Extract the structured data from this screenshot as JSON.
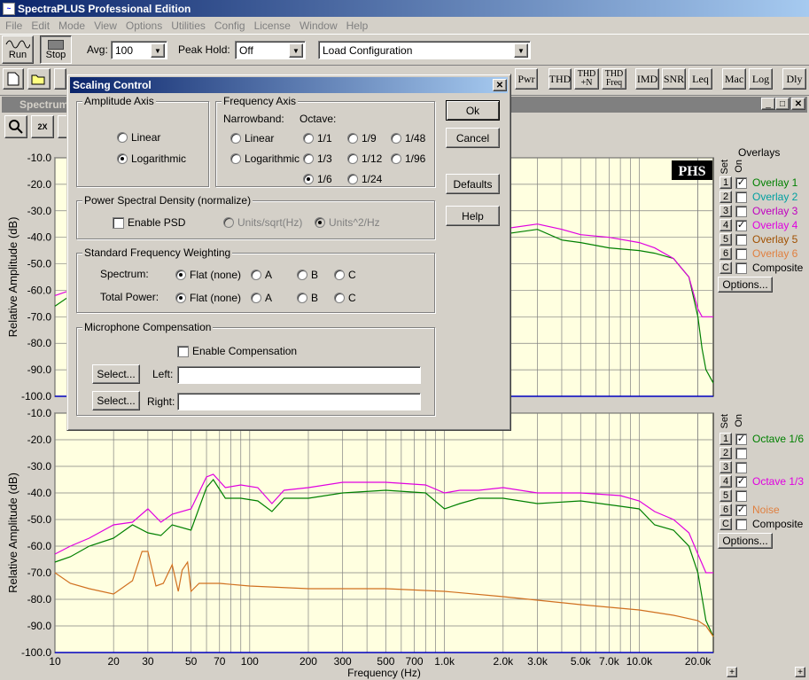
{
  "app": {
    "title": "SpectraPLUS Professional Edition"
  },
  "menu": [
    "File",
    "Edit",
    "Mode",
    "View",
    "Options",
    "Utilities",
    "Config",
    "License",
    "Window",
    "Help"
  ],
  "toolbar": {
    "run_label": "Run",
    "stop_label": "Stop",
    "avg_label": "Avg:",
    "avg_value": "100",
    "peak_label": "Peak Hold:",
    "peak_value": "Off",
    "config_value": "Load Configuration",
    "buttons": [
      "Pwr",
      "THD",
      "THD +N",
      "THD Freq",
      "IMD",
      "SNR",
      "Leq",
      "Mac",
      "Log",
      "Dly"
    ]
  },
  "child_window": {
    "title": "Spectrum",
    "zoom_label": "2X"
  },
  "dialog": {
    "title": "Scaling Control",
    "ok": "Ok",
    "cancel": "Cancel",
    "defaults": "Defaults",
    "help": "Help",
    "amplitude_axis": {
      "title": "Amplitude Axis",
      "linear": "Linear",
      "log": "Logarithmic",
      "selected": "Logarithmic"
    },
    "frequency_axis": {
      "title": "Frequency Axis",
      "narrowband": "Narrowband:",
      "octave": "Octave:",
      "linear": "Linear",
      "log": "Logarithmic",
      "octaves": [
        "1/1",
        "1/9",
        "1/48",
        "1/3",
        "1/12",
        "1/96",
        "1/6",
        "1/24"
      ],
      "selected": "1/6"
    },
    "psd": {
      "title": "Power Spectral Density (normalize)",
      "enable": "Enable PSD",
      "opt1": "Units/sqrt(Hz)",
      "opt2": "Units^2/Hz"
    },
    "weighting": {
      "title": "Standard Frequency Weighting",
      "spectrum": "Spectrum:",
      "total": "Total Power:",
      "flat": "Flat (none)",
      "a": "A",
      "b": "B",
      "c": "C"
    },
    "mic": {
      "title": "Microphone Compensation",
      "enable": "Enable Compensation",
      "select": "Select...",
      "left": "Left:",
      "right": "Right:",
      "left_value": "",
      "right_value": ""
    }
  },
  "overlays_top": {
    "header": "Overlays",
    "set": "Set",
    "on": "On",
    "items": [
      {
        "set": "1",
        "label": "Overlay 1",
        "on": true,
        "color": "#008000"
      },
      {
        "set": "2",
        "label": "Overlay 2",
        "on": false,
        "color": "#00a0a0"
      },
      {
        "set": "3",
        "label": "Overlay 3",
        "on": false,
        "color": "#c000c0"
      },
      {
        "set": "4",
        "label": "Overlay 4",
        "on": true,
        "color": "#e000e0"
      },
      {
        "set": "5",
        "label": "Overlay 5",
        "on": false,
        "color": "#a05000"
      },
      {
        "set": "6",
        "label": "Overlay 6",
        "on": false,
        "color": "#e08040"
      },
      {
        "set": "C",
        "label": "Composite",
        "on": false,
        "color": "#000000"
      }
    ],
    "options": "Options..."
  },
  "overlays_bottom": {
    "set": "Set",
    "on": "On",
    "items": [
      {
        "set": "1",
        "label": "Octave 1/6",
        "on": true,
        "color": "#008000"
      },
      {
        "set": "2",
        "label": "",
        "on": false,
        "color": "#000000"
      },
      {
        "set": "3",
        "label": "",
        "on": false,
        "color": "#000000"
      },
      {
        "set": "4",
        "label": "Octave 1/3",
        "on": true,
        "color": "#e000e0"
      },
      {
        "set": "5",
        "label": "",
        "on": false,
        "color": "#000000"
      },
      {
        "set": "6",
        "label": "Noise",
        "on": true,
        "color": "#e08040"
      },
      {
        "set": "C",
        "label": "Composite",
        "on": false,
        "color": "#000000"
      }
    ],
    "options": "Options..."
  },
  "chart_data": [
    {
      "type": "line",
      "ylabel": "Relative Amplitude (dB)",
      "ylim": [
        -100,
        -10
      ],
      "yticks": [
        "-10.0",
        "-20.0",
        "-30.0",
        "-40.0",
        "-50.0",
        "-60.0",
        "-70.0",
        "-80.0",
        "-90.0",
        "-100.0"
      ],
      "xscale": "log",
      "watermark": "PHS",
      "grid": true,
      "series": [
        {
          "name": "Overlay 1",
          "color": "#008000",
          "x": [
            10,
            12,
            3000,
            4000,
            5000,
            7000,
            10000,
            12000,
            15000,
            18000,
            20000,
            21000,
            22000,
            24000
          ],
          "y": [
            -66,
            -62,
            -37,
            -41,
            -42,
            -44,
            -45,
            -46,
            -48,
            -55,
            -70,
            -82,
            -90,
            -95
          ]
        },
        {
          "name": "Overlay 4",
          "color": "#e000e0",
          "x": [
            10,
            12,
            3000,
            4000,
            5000,
            7000,
            10000,
            12000,
            15000,
            18000,
            20000,
            21000,
            22000,
            24000
          ],
          "y": [
            -62,
            -60,
            -35,
            -37,
            -39,
            -40,
            -42,
            -44,
            -48,
            -55,
            -67,
            -70,
            -70,
            -70
          ]
        }
      ]
    },
    {
      "type": "line",
      "xlabel": "Frequency (Hz)",
      "ylabel": "Relative Amplitude (dB)",
      "ylim": [
        -100,
        -10
      ],
      "yticks": [
        "-10.0",
        "-20.0",
        "-30.0",
        "-40.0",
        "-50.0",
        "-60.0",
        "-70.0",
        "-80.0",
        "-90.0",
        "-100.0"
      ],
      "xscale": "log",
      "xlim": [
        10,
        24000
      ],
      "xticks": [
        "10",
        "20",
        "30",
        "50",
        "70",
        "100",
        "200",
        "300",
        "500",
        "700",
        "1.0k",
        "2.0k",
        "3.0k",
        "5.0k",
        "7.0k",
        "10.0k",
        "20.0k"
      ],
      "grid": true,
      "series": [
        {
          "name": "Octave 1/6",
          "color": "#008000",
          "x": [
            10,
            12,
            15,
            20,
            25,
            30,
            35,
            40,
            50,
            60,
            65,
            75,
            90,
            110,
            130,
            150,
            200,
            300,
            500,
            800,
            1000,
            1200,
            1500,
            2000,
            3000,
            5000,
            8000,
            10000,
            12000,
            15000,
            18000,
            20000,
            22000,
            24000
          ],
          "y": [
            -66,
            -64,
            -60,
            -57,
            -52,
            -55,
            -56,
            -52,
            -54,
            -38,
            -35,
            -42,
            -42,
            -43,
            -47,
            -42,
            -42,
            -40,
            -39,
            -40,
            -46,
            -44,
            -42,
            -42,
            -44,
            -43,
            -45,
            -46,
            -52,
            -54,
            -60,
            -70,
            -88,
            -94
          ]
        },
        {
          "name": "Octave 1/3",
          "color": "#e000e0",
          "x": [
            10,
            12,
            15,
            20,
            25,
            30,
            35,
            40,
            50,
            60,
            65,
            75,
            90,
            110,
            130,
            150,
            200,
            300,
            500,
            800,
            1000,
            1200,
            1500,
            2000,
            3000,
            5000,
            8000,
            10000,
            12000,
            15000,
            18000,
            20000,
            22000,
            24000
          ],
          "y": [
            -63,
            -60,
            -57,
            -52,
            -51,
            -46,
            -51,
            -48,
            -46,
            -34,
            -33,
            -38,
            -37,
            -38,
            -44,
            -39,
            -38,
            -36,
            -36,
            -37,
            -40,
            -39,
            -39,
            -38,
            -40,
            -40,
            -41,
            -43,
            -47,
            -50,
            -55,
            -63,
            -70,
            -70
          ]
        },
        {
          "name": "Noise",
          "color": "#d07020",
          "x": [
            10,
            12,
            15,
            20,
            25,
            28,
            30,
            33,
            36,
            40,
            43,
            45,
            48,
            50,
            55,
            70,
            100,
            200,
            500,
            1000,
            2000,
            5000,
            10000,
            15000,
            20000,
            22000,
            24000
          ],
          "y": [
            -70,
            -74,
            -76,
            -78,
            -73,
            -62,
            -62,
            -75,
            -74,
            -67,
            -77,
            -69,
            -66,
            -77,
            -74,
            -74,
            -75,
            -76,
            -76,
            -77,
            -79,
            -82,
            -84,
            -86,
            -88,
            -90,
            -94
          ]
        }
      ]
    }
  ]
}
